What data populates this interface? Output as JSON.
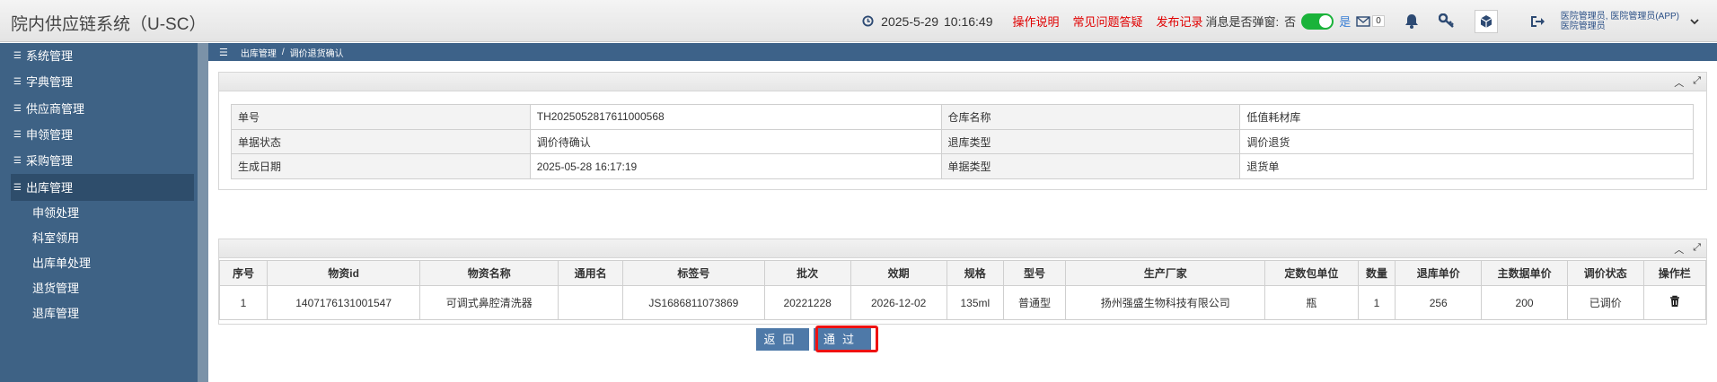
{
  "header": {
    "app_title": "院内供应链系统（U-SC）",
    "date": "2025-5-29",
    "time": "10:16:49",
    "links": [
      "操作说明",
      "常见问题答疑",
      "发布记录"
    ],
    "popup_label": "消息是否弹窗:",
    "toggle_off": "否",
    "toggle_on": "是",
    "mail_count": "0",
    "user_line1": "医院管理员, 医院管理员(APP)",
    "user_line2": "医院管理员"
  },
  "sidebar": {
    "items": [
      {
        "label": "系统管理"
      },
      {
        "label": "字典管理"
      },
      {
        "label": "供应商管理"
      },
      {
        "label": "申领管理"
      },
      {
        "label": "采购管理"
      },
      {
        "label": "出库管理"
      }
    ],
    "subitems": [
      "申领处理",
      "科室领用",
      "出库单处理",
      "退货管理",
      "退库管理"
    ]
  },
  "breadcrumb": {
    "path": "出库管理",
    "sep": "/",
    "current": "调价退货确认"
  },
  "info": {
    "rows": [
      {
        "l1": "单号",
        "v1": "TH2025052817611000568",
        "l2": "仓库名称",
        "v2": "低值耗材库"
      },
      {
        "l1": "单据状态",
        "v1": "调价待确认",
        "l2": "退库类型",
        "v2": "调价退货"
      },
      {
        "l1": "生成日期",
        "v1": "2025-05-28 16:17:19",
        "l2": "单据类型",
        "v2": "退货单"
      }
    ]
  },
  "table": {
    "headers": [
      "序号",
      "物资id",
      "物资名称",
      "通用名",
      "标签号",
      "批次",
      "效期",
      "规格",
      "型号",
      "生产厂家",
      "定数包单位",
      "数量",
      "退库单价",
      "主数据单价",
      "调价状态",
      "操作栏"
    ],
    "rows": [
      [
        "1",
        "1407176131001547",
        "可调式鼻腔清洗器",
        "",
        "JS1686811073869",
        "20221228",
        "2026-12-02",
        "135ml",
        "普通型",
        "扬州强盛生物科技有限公司",
        "瓶",
        "1",
        "256",
        "200",
        "已调价"
      ]
    ]
  },
  "buttons": {
    "back": "返回",
    "pass": "通过"
  },
  "colors": {
    "nav_bg": "#3e6285",
    "accent": "#4e79a8",
    "link_red": "#e00000",
    "highlight": "#ee1111"
  }
}
